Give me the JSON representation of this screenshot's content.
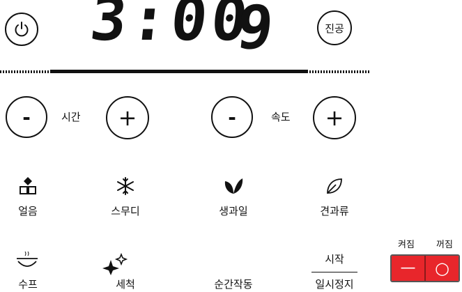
{
  "display": {
    "time": "3:00",
    "speed": "9"
  },
  "buttons": {
    "vacuum_label": "진공",
    "time_minus": "-",
    "time_plus": "+",
    "speed_minus": "-",
    "speed_plus": "+"
  },
  "labels": {
    "time": "시간",
    "speed": "속도"
  },
  "progress": {
    "fraction": 0.1
  },
  "programs": [
    {
      "label": "얼음",
      "icon": "ice-cubes-icon"
    },
    {
      "label": "스무디",
      "icon": "snowflake-icon"
    },
    {
      "label": "생과일",
      "icon": "leaves-icon"
    },
    {
      "label": "견과류",
      "icon": "leaf-outline-icon"
    },
    {
      "label": "수프",
      "icon": "soup-bowl-icon"
    },
    {
      "label": "세척",
      "icon": "sparkle-icon"
    },
    {
      "label": "순간작동",
      "icon": ""
    }
  ],
  "start_pause": {
    "top": "시작",
    "bottom": "일시정지"
  },
  "power_switch": {
    "on_label": "켜짐",
    "off_label": "꺼짐",
    "on_symbol": "—",
    "off_symbol": "○",
    "color": "#e8262b"
  }
}
